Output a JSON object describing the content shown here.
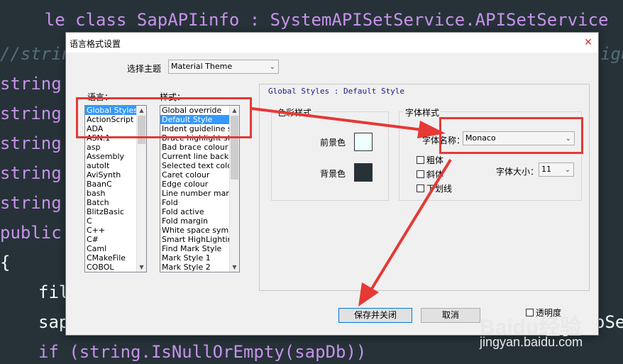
{
  "editor": {
    "lines": [
      {
        "kind": "cut",
        "text": "le class SapAPIinfo : SystemAPISetService.APISetService"
      },
      {
        "kind": "comment",
        "text": "//string"
      },
      {
        "kind": "string",
        "text": "string"
      },
      {
        "kind": "string",
        "text": "string"
      },
      {
        "kind": "string",
        "text": "string"
      },
      {
        "kind": "string",
        "text": "string"
      },
      {
        "kind": "string",
        "text": "string"
      },
      {
        "kind": "public",
        "text": "public"
      },
      {
        "kind": "brace",
        "text": "{"
      },
      {
        "kind": "plain",
        "text": "fil"
      },
      {
        "kind": "plain",
        "text": "sap"
      },
      {
        "kind": "if",
        "text": "if (string.IsNullOrEmpty(sapDb))"
      }
    ],
    "right_fragments": {
      "gu": "igu",
      "se": "oSe"
    }
  },
  "dialog": {
    "title": "语言格式设置",
    "close_icon": "close-icon",
    "theme_label": "选择主题",
    "theme_value": "Material Theme",
    "language_label": "语言：",
    "style_label": "样式：",
    "languages": [
      "Global Styles",
      "ActionScript",
      "ADA",
      "ASN.1",
      "asp",
      "Assembly",
      "autoIt",
      "AviSynth",
      "BaanC",
      "bash",
      "Batch",
      "BlitzBasic",
      "C",
      "C++",
      "C#",
      "Caml",
      "CMakeFile",
      "COBOL"
    ],
    "selected_language": "Global Styles",
    "styles": [
      "Global override",
      "Default Style",
      "Indent guideline style",
      "Brace highlight style",
      "Bad brace colour",
      "Current line background",
      "Selected text colour",
      "Caret colour",
      "Edge colour",
      "Line number margin",
      "Fold",
      "Fold active",
      "Fold margin",
      "White space symbol",
      "Smart HighLighting",
      "Find Mark Style",
      "Mark Style 1",
      "Mark Style 2"
    ],
    "selected_style": "Default Style",
    "style_heading": "Global Styles : Default Style",
    "color_group_title": "色彩样式",
    "fg_label": "前景色",
    "bg_label": "背景色",
    "fg_color": "#eeffff",
    "bg_color": "#263238",
    "font_group_title": "字体样式",
    "font_name_label": "字体名称：",
    "font_name_value": "Monaco",
    "bold_label": "粗体",
    "italic_label": "斜体",
    "underline_label": "下划线",
    "font_size_label": "字体大小：",
    "font_size_value": "11",
    "save_close_label": "保存并关闭",
    "cancel_label": "取消",
    "transparency_label": "透明度"
  },
  "watermark": {
    "brand": "Baidu经验",
    "url": "jingyan.baidu.com"
  },
  "colors": {
    "annotation_red": "#e53935",
    "accent": "#3399ff"
  }
}
